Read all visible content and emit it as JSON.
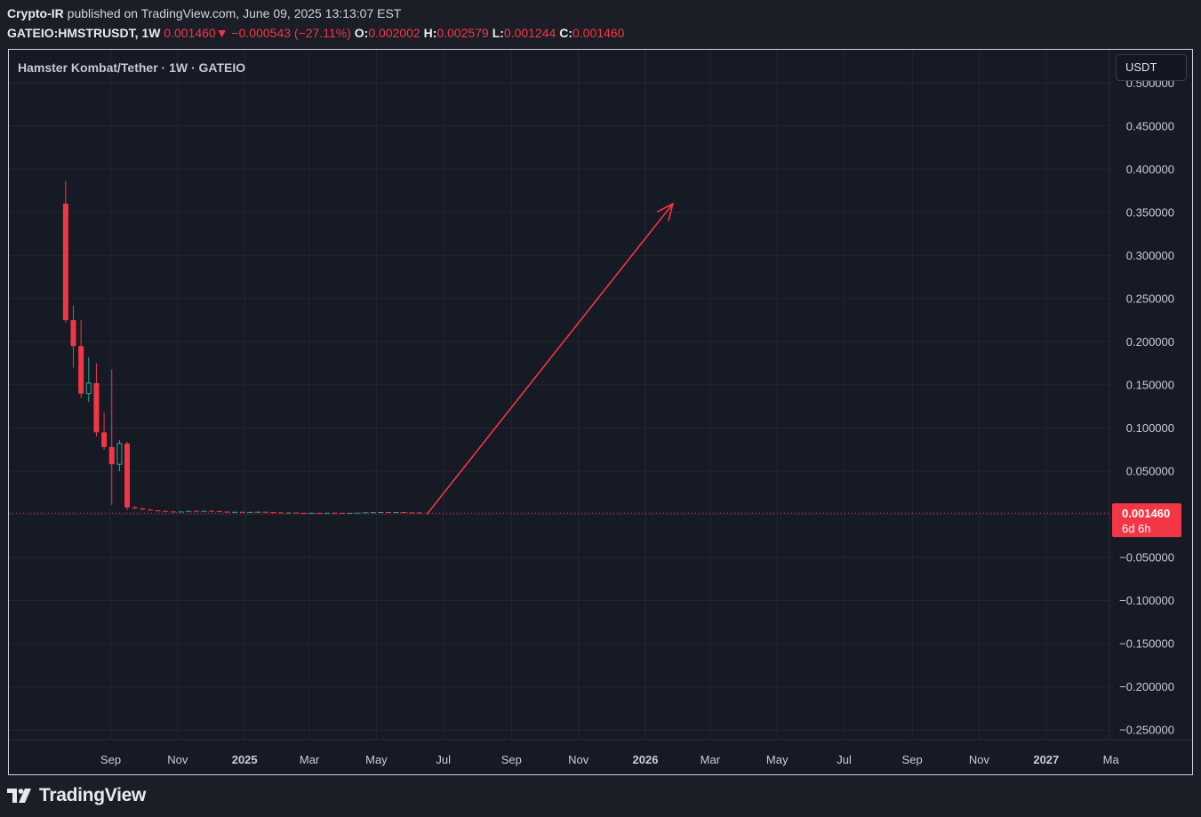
{
  "header": {
    "author": "Crypto-IR",
    "published_text": "published on TradingView.com, June 09, 2025 13:13:07 EST",
    "symbol": "GATEIO:HMSTRUSDT, 1W",
    "last": "0.001460",
    "change": "−0.000543 (−27.11%)",
    "o_label": "O:",
    "o_value": "0.002002",
    "h_label": "H:",
    "h_value": "0.002579",
    "l_label": "L:",
    "l_value": "0.001244",
    "c_label": "C:",
    "c_value": "0.001460"
  },
  "chart_title": "Hamster Kombat/Tether · 1W · GATEIO",
  "currency_button": "USDT",
  "price_tag": {
    "value": "0.001460",
    "countdown": "6d 6h"
  },
  "footer": {
    "brand": "TradingView"
  },
  "colors": {
    "up": "#22ab94",
    "down": "#f23645",
    "background": "#161a25",
    "arrow": "#f23645"
  },
  "chart_data": {
    "type": "candlestick",
    "title": "Hamster Kombat/Tether · 1W · GATEIO",
    "y_ticks": [
      "0.500000",
      "0.450000",
      "0.400000",
      "0.350000",
      "0.300000",
      "0.250000",
      "0.200000",
      "0.150000",
      "0.100000",
      "0.050000",
      "",
      "−0.050000",
      "−0.100000",
      "−0.150000",
      "−0.200000",
      "−0.250000"
    ],
    "y_tick_values": [
      0.5,
      0.45,
      0.4,
      0.35,
      0.3,
      0.25,
      0.2,
      0.15,
      0.1,
      0.05,
      0,
      -0.05,
      -0.1,
      -0.15,
      -0.2,
      -0.25
    ],
    "x_ticks": [
      {
        "label": "Sep",
        "date": "2024-09-01",
        "bold": false
      },
      {
        "label": "Nov",
        "date": "2024-11-01",
        "bold": false
      },
      {
        "label": "2025",
        "date": "2025-01-01",
        "bold": true
      },
      {
        "label": "Mar",
        "date": "2025-03-01",
        "bold": false
      },
      {
        "label": "May",
        "date": "2025-05-01",
        "bold": false
      },
      {
        "label": "Jul",
        "date": "2025-07-01",
        "bold": false
      },
      {
        "label": "Sep",
        "date": "2025-09-01",
        "bold": false
      },
      {
        "label": "Nov",
        "date": "2025-11-01",
        "bold": false
      },
      {
        "label": "2026",
        "date": "2026-01-01",
        "bold": true
      },
      {
        "label": "Mar",
        "date": "2026-03-01",
        "bold": false
      },
      {
        "label": "May",
        "date": "2026-05-01",
        "bold": false
      },
      {
        "label": "Jul",
        "date": "2026-07-01",
        "bold": false
      },
      {
        "label": "Sep",
        "date": "2026-09-01",
        "bold": false
      },
      {
        "label": "Nov",
        "date": "2026-11-01",
        "bold": false
      },
      {
        "label": "2027",
        "date": "2027-01-01",
        "bold": true
      },
      {
        "label": "Ma",
        "date": "2027-03-01",
        "bold": false
      }
    ],
    "candles": [
      {
        "date": "2024-07-22",
        "open": 0.36,
        "high": 0.386,
        "low": 0.222,
        "close": 0.225
      },
      {
        "date": "2024-07-29",
        "open": 0.225,
        "high": 0.242,
        "low": 0.17,
        "close": 0.195
      },
      {
        "date": "2024-08-05",
        "open": 0.195,
        "high": 0.225,
        "low": 0.135,
        "close": 0.14
      },
      {
        "date": "2024-08-12",
        "open": 0.14,
        "high": 0.182,
        "low": 0.13,
        "close": 0.152
      },
      {
        "date": "2024-08-19",
        "open": 0.152,
        "high": 0.175,
        "low": 0.09,
        "close": 0.095
      },
      {
        "date": "2024-08-26",
        "open": 0.095,
        "high": 0.118,
        "low": 0.075,
        "close": 0.078
      },
      {
        "date": "2024-09-02",
        "open": 0.078,
        "high": 0.168,
        "low": 0.011,
        "close": 0.058
      },
      {
        "date": "2024-09-09",
        "open": 0.058,
        "high": 0.086,
        "low": 0.05,
        "close": 0.082
      },
      {
        "date": "2024-09-16",
        "open": 0.082,
        "high": 0.084,
        "low": 0.005,
        "close": 0.008
      },
      {
        "date": "2024-09-23",
        "open": 0.008,
        "high": 0.0095,
        "low": 0.006,
        "close": 0.0068
      },
      {
        "date": "2024-09-30",
        "open": 0.0068,
        "high": 0.0075,
        "low": 0.0052,
        "close": 0.0055
      },
      {
        "date": "2024-10-07",
        "open": 0.0055,
        "high": 0.006,
        "low": 0.0042,
        "close": 0.0045
      },
      {
        "date": "2024-10-14",
        "open": 0.0045,
        "high": 0.0048,
        "low": 0.0035,
        "close": 0.0038
      },
      {
        "date": "2024-10-21",
        "open": 0.0038,
        "high": 0.0042,
        "low": 0.003,
        "close": 0.0032
      },
      {
        "date": "2024-10-28",
        "open": 0.0032,
        "high": 0.0036,
        "low": 0.0025,
        "close": 0.0027
      },
      {
        "date": "2024-11-04",
        "open": 0.0027,
        "high": 0.0034,
        "low": 0.0025,
        "close": 0.0032
      },
      {
        "date": "2024-11-11",
        "open": 0.0032,
        "high": 0.0042,
        "low": 0.003,
        "close": 0.0039
      },
      {
        "date": "2024-11-18",
        "open": 0.0039,
        "high": 0.0045,
        "low": 0.0034,
        "close": 0.0036
      },
      {
        "date": "2024-11-25",
        "open": 0.0036,
        "high": 0.0041,
        "low": 0.0031,
        "close": 0.0039
      },
      {
        "date": "2024-12-02",
        "open": 0.0039,
        "high": 0.0048,
        "low": 0.0035,
        "close": 0.0037
      },
      {
        "date": "2024-12-09",
        "open": 0.0037,
        "high": 0.004,
        "low": 0.0029,
        "close": 0.0031
      },
      {
        "date": "2024-12-16",
        "open": 0.0031,
        "high": 0.0034,
        "low": 0.0024,
        "close": 0.0026
      },
      {
        "date": "2024-12-23",
        "open": 0.0026,
        "high": 0.003,
        "low": 0.0023,
        "close": 0.0028
      },
      {
        "date": "2024-12-30",
        "open": 0.0028,
        "high": 0.0031,
        "low": 0.0024,
        "close": 0.0025
      },
      {
        "date": "2025-01-06",
        "open": 0.0025,
        "high": 0.0029,
        "low": 0.0021,
        "close": 0.0027
      },
      {
        "date": "2025-01-13",
        "open": 0.0027,
        "high": 0.0032,
        "low": 0.0024,
        "close": 0.0029
      },
      {
        "date": "2025-01-20",
        "open": 0.0029,
        "high": 0.003,
        "low": 0.0022,
        "close": 0.0024
      },
      {
        "date": "2025-01-27",
        "open": 0.0024,
        "high": 0.0026,
        "low": 0.0019,
        "close": 0.0021
      },
      {
        "date": "2025-02-03",
        "open": 0.0021,
        "high": 0.0023,
        "low": 0.0016,
        "close": 0.0018
      },
      {
        "date": "2025-02-10",
        "open": 0.0018,
        "high": 0.0021,
        "low": 0.0016,
        "close": 0.0019
      },
      {
        "date": "2025-02-17",
        "open": 0.0019,
        "high": 0.002,
        "low": 0.0015,
        "close": 0.0016
      },
      {
        "date": "2025-02-24",
        "open": 0.0016,
        "high": 0.0018,
        "low": 0.0013,
        "close": 0.0015
      },
      {
        "date": "2025-03-03",
        "open": 0.0015,
        "high": 0.0018,
        "low": 0.0014,
        "close": 0.0017
      },
      {
        "date": "2025-03-10",
        "open": 0.0017,
        "high": 0.0019,
        "low": 0.0015,
        "close": 0.0016
      },
      {
        "date": "2025-03-17",
        "open": 0.0016,
        "high": 0.0018,
        "low": 0.0014,
        "close": 0.0017
      },
      {
        "date": "2025-03-24",
        "open": 0.0017,
        "high": 0.0019,
        "low": 0.0015,
        "close": 0.0016
      },
      {
        "date": "2025-03-31",
        "open": 0.0016,
        "high": 0.0017,
        "low": 0.0013,
        "close": 0.0014
      },
      {
        "date": "2025-04-07",
        "open": 0.0014,
        "high": 0.0017,
        "low": 0.0012,
        "close": 0.0016
      },
      {
        "date": "2025-04-14",
        "open": 0.0016,
        "high": 0.0019,
        "low": 0.0015,
        "close": 0.0018
      },
      {
        "date": "2025-04-21",
        "open": 0.0018,
        "high": 0.0024,
        "low": 0.0017,
        "close": 0.0022
      },
      {
        "date": "2025-04-28",
        "open": 0.0022,
        "high": 0.0027,
        "low": 0.002,
        "close": 0.0024
      },
      {
        "date": "2025-05-05",
        "open": 0.0024,
        "high": 0.0028,
        "low": 0.0021,
        "close": 0.0026
      },
      {
        "date": "2025-05-12",
        "open": 0.0026,
        "high": 0.0029,
        "low": 0.0022,
        "close": 0.0023
      },
      {
        "date": "2025-05-19",
        "open": 0.0023,
        "high": 0.0026,
        "low": 0.002,
        "close": 0.0025
      },
      {
        "date": "2025-05-26",
        "open": 0.0025,
        "high": 0.0026,
        "low": 0.0019,
        "close": 0.0021
      },
      {
        "date": "2025-06-02",
        "open": 0.0021,
        "high": 0.0023,
        "low": 0.0019,
        "close": 0.002
      },
      {
        "date": "2025-06-09",
        "open": 0.002002,
        "high": 0.002579,
        "low": 0.001244,
        "close": 0.00146
      }
    ],
    "last_price": 0.00146,
    "annotation": {
      "type": "arrow",
      "from": {
        "date": "2025-06-16",
        "price": 0.0
      },
      "to": {
        "date": "2026-01-26",
        "price": 0.36
      }
    }
  }
}
